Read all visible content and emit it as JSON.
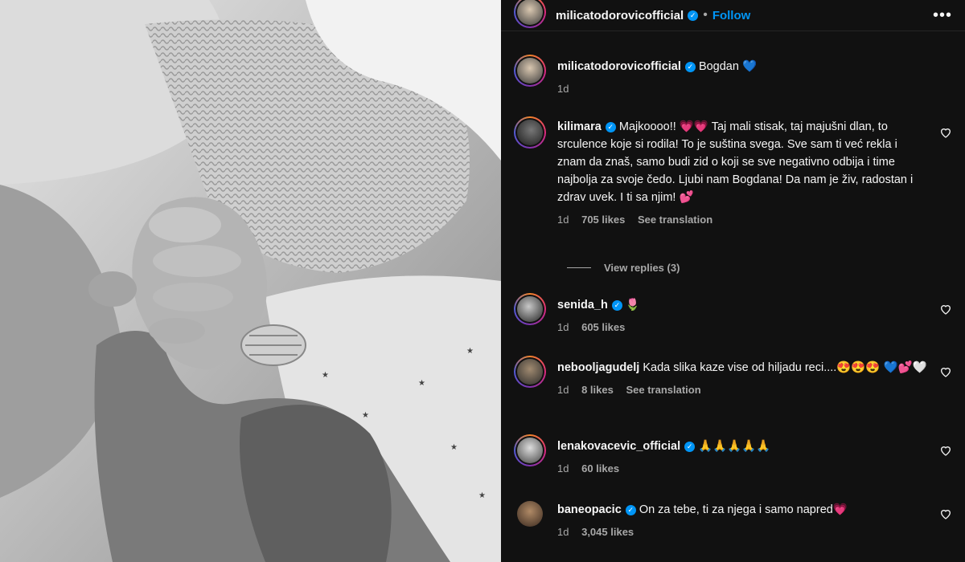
{
  "post": {
    "author": "milicatodorovicofficial",
    "follow_label": "Follow",
    "dot": "•",
    "more": "•••",
    "caption": {
      "username": "milicatodorovicofficial",
      "text": "Bogdan 💙",
      "time": "1d"
    }
  },
  "comments": [
    {
      "username": "kilimara",
      "text": "Majkoooo!! 💗💗 Taj mali stisak, taj majušni dlan, to srculence koje si rodila! To je suština svega. Sve sam ti već rekla i znam da znaš, samo budi zid o koji se sve negativno odbija i time najbolja za svoje čedo. Ljubi nam Bogdana! Da nam je živ, radostan i zdrav uvek. I ti sa njim! 💕",
      "time": "1d",
      "likes": "705 likes",
      "translation": "See translation"
    },
    {
      "username": "senida_h",
      "text": "🌷",
      "time": "1d",
      "likes": "605 likes"
    },
    {
      "username": "nebooljagudelj",
      "text": "Kada slika kaze vise od hiljadu reci....😍😍😍 💙💕🤍",
      "time": "1d",
      "likes": "8 likes",
      "translation": "See translation"
    },
    {
      "username": "lenakovacevic_official",
      "text": "🙏🙏🙏🙏🙏",
      "time": "1d",
      "likes": "60 likes"
    },
    {
      "username": "baneopacic",
      "text": "On za tebe, ti za njega i samo napred💗",
      "time": "1d",
      "likes": "3,045 likes"
    }
  ],
  "view_replies": "View replies (3)",
  "icons": {
    "verified": "verified-badge-icon",
    "heart": "heart-icon",
    "more": "more-options-icon"
  },
  "colors": {
    "accent": "#0095f6",
    "panel_bg": "#111111",
    "muted": "#a8a8a8"
  }
}
